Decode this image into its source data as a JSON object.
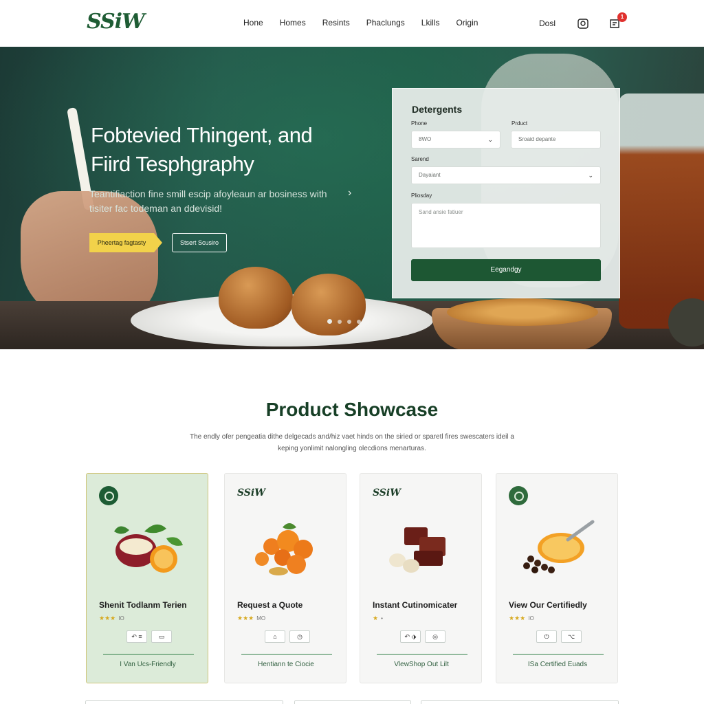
{
  "header": {
    "logo": "SSiW",
    "nav": [
      "Hone",
      "Homes",
      "Resints",
      "Phaclungs",
      "Lkills",
      "Origin"
    ],
    "right_link": "Dosl",
    "cart_count": "1",
    "icons": [
      "account-icon",
      "cart-icon"
    ]
  },
  "hero": {
    "title": "Fobtevied Thingent, and Fiird Tesphgraphy",
    "subtitle": "Teantifiaction fine smill escip afoyleaun ar bosiness with tisiter fac todeman an ddevisid!",
    "primary_button": "Pheertag fagtasty",
    "secondary_button": "Stsert Scusiro",
    "slides": 4,
    "active_slide": 1
  },
  "form": {
    "title": "Detergents",
    "label_1": "Phone",
    "label_2": "Prduct",
    "field_1": "8WO",
    "field_2": "Sroaid depante",
    "label_3": "Sarend",
    "field_3": "Dayaiant",
    "label_4": "Pliosday",
    "textarea_placeholder": "Sand ansie fatiuer",
    "submit": "Eegandgy"
  },
  "showcase": {
    "title": "Product Showcase",
    "subtitle": "The endly ofer pengeatia dithe delgecads and/hiz vaet hinds on the siried or sparetl fires swescaters ideil a keping yonlimit nalongling olecdions menarturas."
  },
  "cards": [
    {
      "title": "Shenit Todlanm Terien",
      "rating_text": "IO",
      "stars": "★★★",
      "link": "I Van Ucs-Friendly",
      "badge": "leaf",
      "image": "fruit-bowl",
      "actions": [
        "↶ ≡",
        "▭"
      ]
    },
    {
      "title": "Request a Quote",
      "rating_text": "MO",
      "stars": "★★★",
      "link": "Hentiann te Ciocie",
      "badge": "SSiW",
      "image": "oranges",
      "actions": [
        "⌂",
        "◷"
      ]
    },
    {
      "title": "Instant Cutinomicater",
      "rating_text": "•",
      "stars": "★",
      "link": "VlewShop Out Lilt",
      "badge": "SSiW",
      "image": "chocolate",
      "actions": [
        "↶ ⬗",
        "◎"
      ]
    },
    {
      "title": "View Our Certifiedly",
      "rating_text": "IO",
      "stars": "★★★",
      "link": "ISa Certified Euads",
      "badge": "seal",
      "image": "coffee-orange",
      "actions": [
        "⏻",
        "⌥"
      ]
    }
  ],
  "colors": {
    "brand_green": "#1d5733",
    "accent_yellow": "#f2d24a",
    "cart_badge": "#e0312e"
  }
}
